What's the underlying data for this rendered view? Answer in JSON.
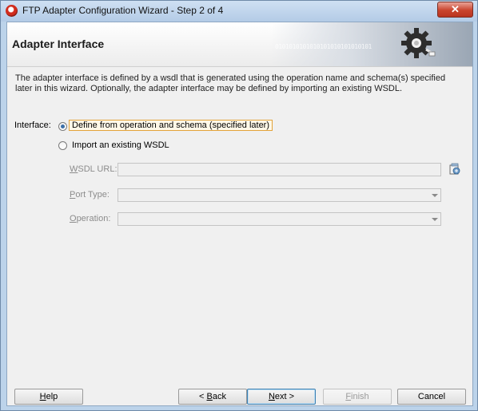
{
  "window": {
    "title": "FTP Adapter Configuration Wizard - Step 2 of 4",
    "close_symbol": "✕"
  },
  "header": {
    "title": "Adapter Interface",
    "binary_text": "0101010101010101010101010101",
    "binary_text_2": "0101010101010101"
  },
  "description": "The adapter interface is defined by a wsdl that is generated using the operation name and schema(s) specified later in this wizard.  Optionally, the adapter interface may be defined by importing an existing WSDL.",
  "form": {
    "interface_label": "Interface:",
    "options": [
      {
        "label": "Define from operation and schema (specified later)",
        "selected": true
      },
      {
        "label": "Import an existing WSDL",
        "selected": false
      }
    ],
    "wsdl_url": {
      "mnemonic": "W",
      "rest": "SDL URL:",
      "value": ""
    },
    "port_type": {
      "mnemonic": "P",
      "rest": "ort Type:",
      "value": ""
    },
    "operation": {
      "mnemonic": "O",
      "rest": "peration:",
      "value": ""
    }
  },
  "buttons": {
    "help": {
      "mnemonic": "H",
      "rest": "elp"
    },
    "back": {
      "prefix": "< ",
      "mnemonic": "B",
      "rest": "ack"
    },
    "next": {
      "mnemonic": "N",
      "rest": "ext >"
    },
    "finish": {
      "mnemonic": "F",
      "rest": "inish",
      "enabled": false
    },
    "cancel": {
      "label": "Cancel"
    }
  },
  "icons": {
    "app": "ftp-adapter-icon",
    "header": "gear-plug-icon",
    "browse": "browse-wsdl-icon",
    "combo": "chevron-down-icon"
  },
  "colors": {
    "accent": "#3c6fa8",
    "focus_border": "#e3a33a",
    "disabled_text": "#8c8c8c",
    "close": "#c9442d"
  }
}
